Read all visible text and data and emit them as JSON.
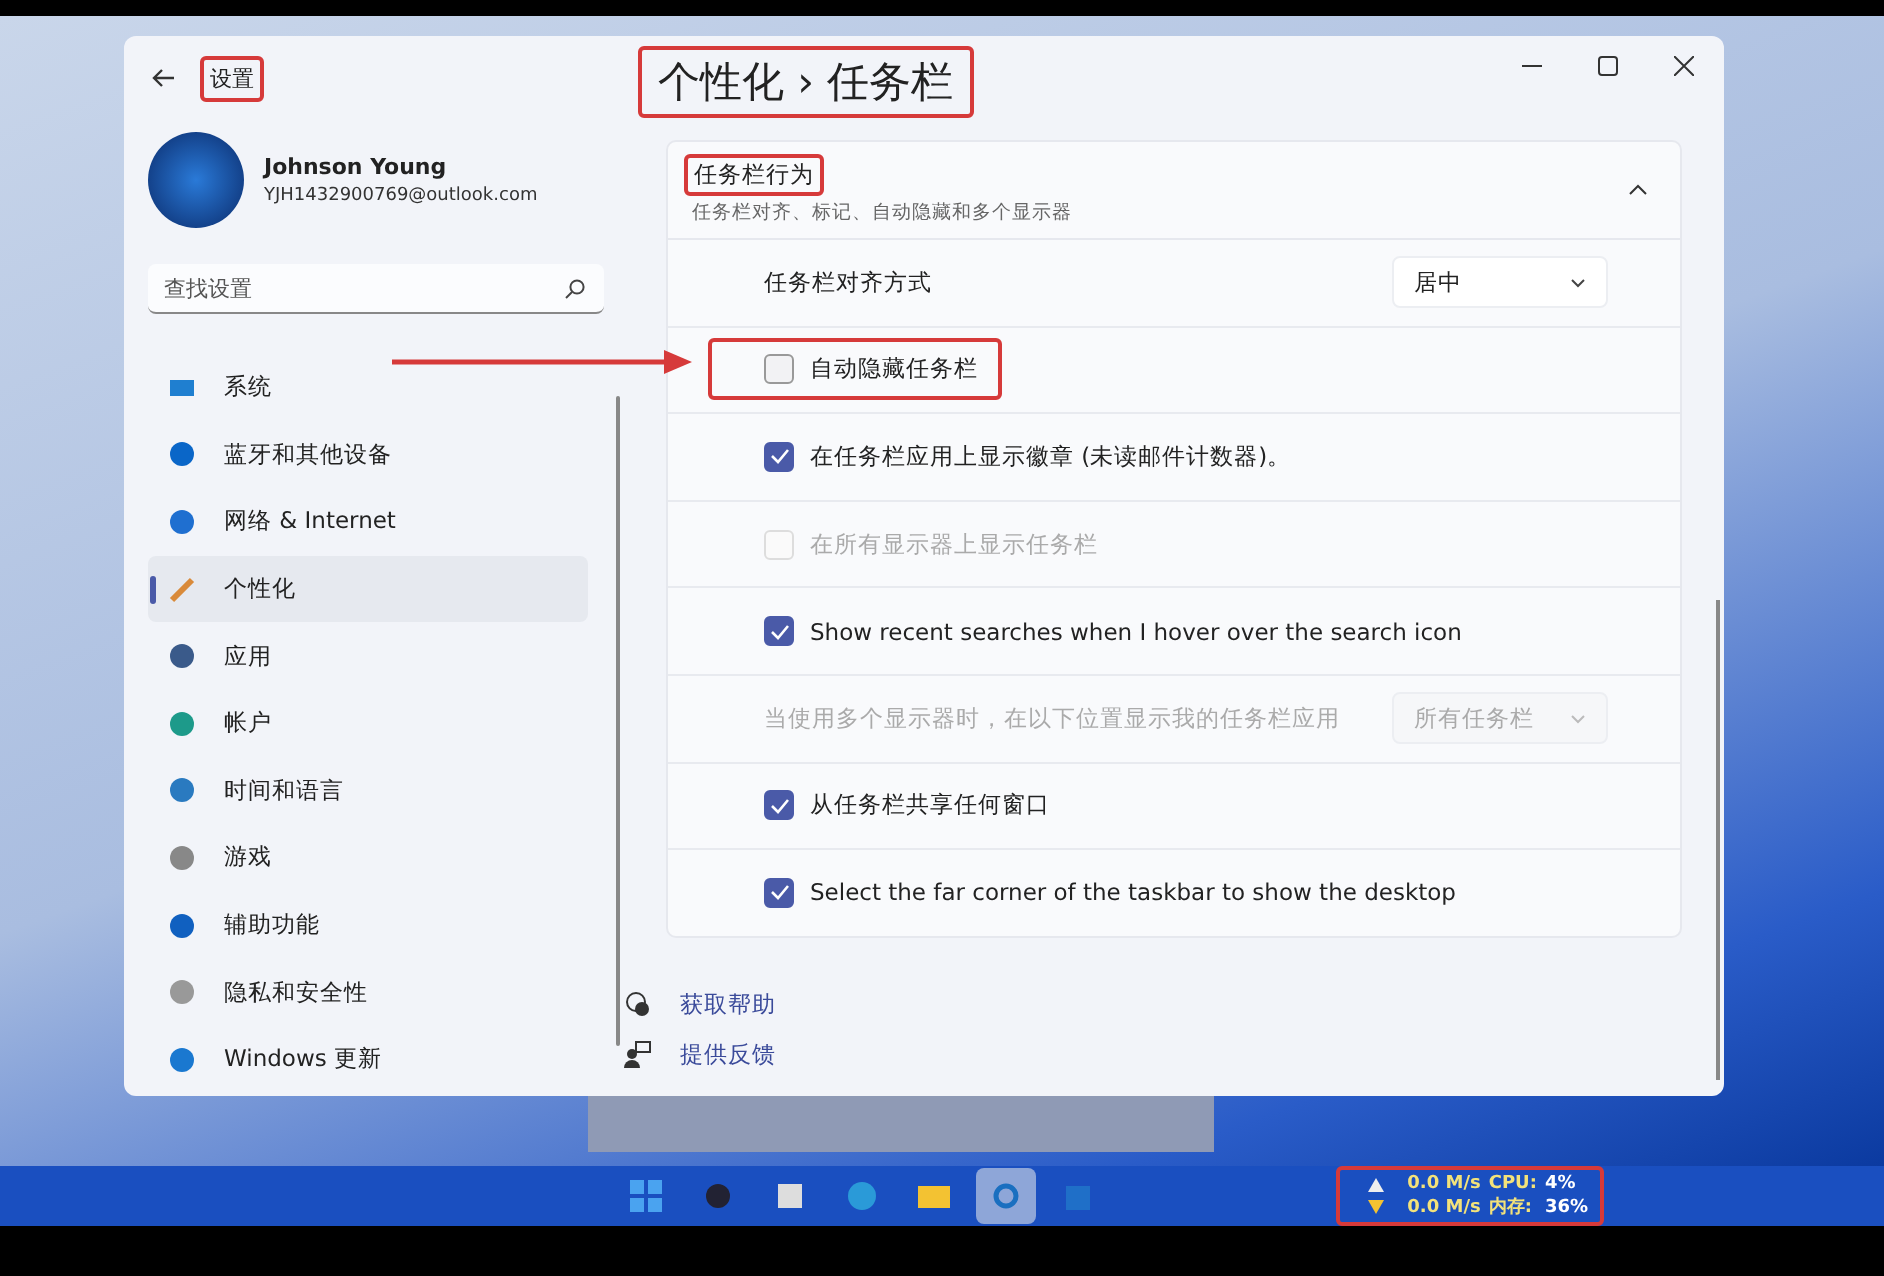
{
  "window": {
    "title": "设置",
    "title_highlighted": true
  },
  "breadcrumb": {
    "parent": "个性化",
    "separator": "›",
    "current": "任务栏",
    "highlighted": true
  },
  "profile": {
    "name": "Johnson Young",
    "email": "YJH1432900769@outlook.com"
  },
  "search": {
    "placeholder": "查找设置"
  },
  "nav": [
    {
      "label": "系统",
      "selected": false
    },
    {
      "label": "蓝牙和其他设备",
      "selected": false
    },
    {
      "label": "网络 & Internet",
      "selected": false
    },
    {
      "label": "个性化",
      "selected": true
    },
    {
      "label": "应用",
      "selected": false
    },
    {
      "label": "帐户",
      "selected": false
    },
    {
      "label": "时间和语言",
      "selected": false
    },
    {
      "label": "游戏",
      "selected": false
    },
    {
      "label": "辅助功能",
      "selected": false
    },
    {
      "label": "隐私和安全性",
      "selected": false
    },
    {
      "label": "Windows 更新",
      "selected": false
    }
  ],
  "section": {
    "title": "任务栏行为",
    "title_highlighted": true,
    "subtitle": "任务栏对齐、标记、自动隐藏和多个显示器",
    "expanded": true
  },
  "rows": [
    {
      "kind": "dropdown",
      "label": "任务栏对齐方式",
      "value": "居中",
      "disabled": false
    },
    {
      "kind": "checkbox",
      "label": "自动隐藏任务栏",
      "checked": false,
      "disabled": false,
      "highlighted": true
    },
    {
      "kind": "checkbox",
      "label": "在任务栏应用上显示徽章 (未读邮件计数器)。",
      "checked": true,
      "disabled": false,
      "highlighted": false
    },
    {
      "kind": "checkbox",
      "label": "在所有显示器上显示任务栏",
      "checked": false,
      "disabled": true,
      "highlighted": false
    },
    {
      "kind": "checkbox",
      "label": "Show recent searches when I hover over the search icon",
      "checked": true,
      "disabled": false,
      "highlighted": false
    },
    {
      "kind": "dropdown",
      "label": "当使用多个显示器时，在以下位置显示我的任务栏应用",
      "value": "所有任务栏",
      "disabled": true
    },
    {
      "kind": "checkbox",
      "label": "从任务栏共享任何窗口",
      "checked": true,
      "disabled": false,
      "highlighted": false
    },
    {
      "kind": "checkbox",
      "label": "Select the far corner of the taskbar to show the desktop",
      "checked": true,
      "disabled": false,
      "highlighted": false
    }
  ],
  "links": [
    {
      "label": "获取帮助"
    },
    {
      "label": "提供反馈"
    }
  ],
  "taskbar": [
    {
      "selected": false
    },
    {
      "selected": false
    },
    {
      "selected": false
    },
    {
      "selected": false
    },
    {
      "selected": false
    },
    {
      "selected": true
    },
    {
      "selected": false
    }
  ],
  "tray": {
    "upload": "0.0 M/s",
    "download": "0.0 M/s",
    "cpu_label": "CPU:",
    "cpu": "4%",
    "mem_label": "内存:",
    "mem": "36%",
    "highlighted": true
  }
}
